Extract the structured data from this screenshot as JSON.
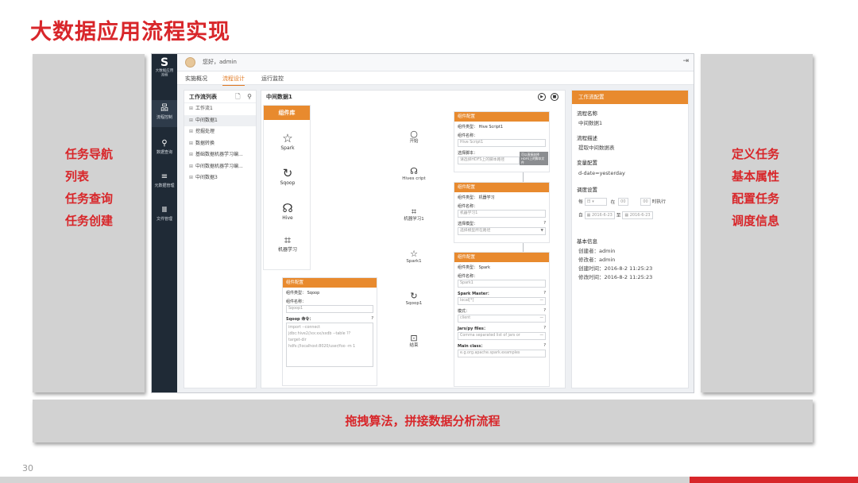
{
  "slide": {
    "title": "大数据应用流程实现",
    "left_panel": [
      "任务导航",
      "列表",
      "任务查询",
      "任务创建"
    ],
    "right_panel": [
      "定义任务",
      "基本属性",
      "配置任务",
      "调度信息"
    ],
    "bottom_text": "拖拽算法，拼接数据分析流程",
    "page_number": "30"
  },
  "app": {
    "logo_text": "大数据应用流程",
    "greeting": "您好，admin",
    "nav": [
      "流程控制",
      "数据查询",
      "元数据管理",
      "文件管理"
    ],
    "tabs": [
      "实施概况",
      "流程设计",
      "运行监控"
    ],
    "active_tab": "流程设计",
    "workflow_list": {
      "title": "工作流列表",
      "items": [
        "工作流1",
        "中间数据1",
        "挖掘处理",
        "数据转换",
        "基础数据机器学习编...",
        "中间数据机器学习编...",
        "中间数据3"
      ]
    },
    "canvas": {
      "title": "中间数据1",
      "library_title": "组件库",
      "library": [
        "Spark",
        "Sqoop",
        "Hive",
        "机器学习"
      ],
      "flow_nodes": [
        "开始",
        "Hives cript",
        "机器学习1",
        "Spark1",
        "Sqoop1",
        "结束"
      ]
    },
    "config_hive": {
      "head": "组件配置",
      "type_label": "组件类型：",
      "type_value": "Hive Script1",
      "name_label": "组件名称：",
      "name_value": "Hive Script1",
      "script_label": "选择脚本：",
      "script_value": "请选择HDFS上的脚本路径",
      "tooltip": "可以直接选择HDFS上的脚本文件"
    },
    "config_ml": {
      "head": "组件配置",
      "type_label": "组件类型：",
      "type_value": "机器学习",
      "name_label": "组件名称：",
      "name_value": "机器学习1",
      "model_label": "选择模型：",
      "model_value": "选择模型所在路径"
    },
    "config_spark": {
      "head": "组件配置",
      "type_label": "组件类型：",
      "type_value": "Spark",
      "name_label": "组件名称：",
      "name_value": "Spark1",
      "master_label": "Spark Master：",
      "master_value": "local[*]",
      "mode_label": "模式：",
      "mode_value": "client",
      "jars_label": "Jars/py files：",
      "jars_value": "Comma separated list of jars or",
      "main_label": "Main class：",
      "main_value": "e.g.org.apache.spark.examples"
    },
    "config_sqoop": {
      "head": "组件配置",
      "type_label": "组件类型：",
      "type_value": "Sqoop",
      "name_label": "组件名称：",
      "name_value": "Sqoop1",
      "cmd_label": "Sqoop 命令：",
      "cmd_lines": [
        "import --connect",
        "jdbc:hive2//xx:xx/xxdb --table ??",
        "target-dir",
        "hdfs://localhost:8020/user/foo -m 1"
      ]
    },
    "task_config": {
      "head": "工作流配置",
      "name_label": "流程名称",
      "name_value": "中间数据1",
      "desc_label": "流程描述",
      "desc_value": "提取中间数据表",
      "var_label": "变量配置",
      "var_value": "d-date=yesterday",
      "schedule_label": "调度设置",
      "sched_every": "每",
      "sched_day": "日",
      "sched_at": "在",
      "sched_hour": "00",
      "sched_minute": "00",
      "sched_suffix": "时执行",
      "date_prefix": "自",
      "date_from": "2016-6-23",
      "date_to_label": "至",
      "date_to": "2016-6-23",
      "basic_label": "基本信息",
      "creator": "创建者：admin",
      "modifier": "修改者：admin",
      "created": "创建时间：2016-8-2  11:25:23",
      "modified": "修改时间：2016-8-2  11:25:23"
    }
  }
}
